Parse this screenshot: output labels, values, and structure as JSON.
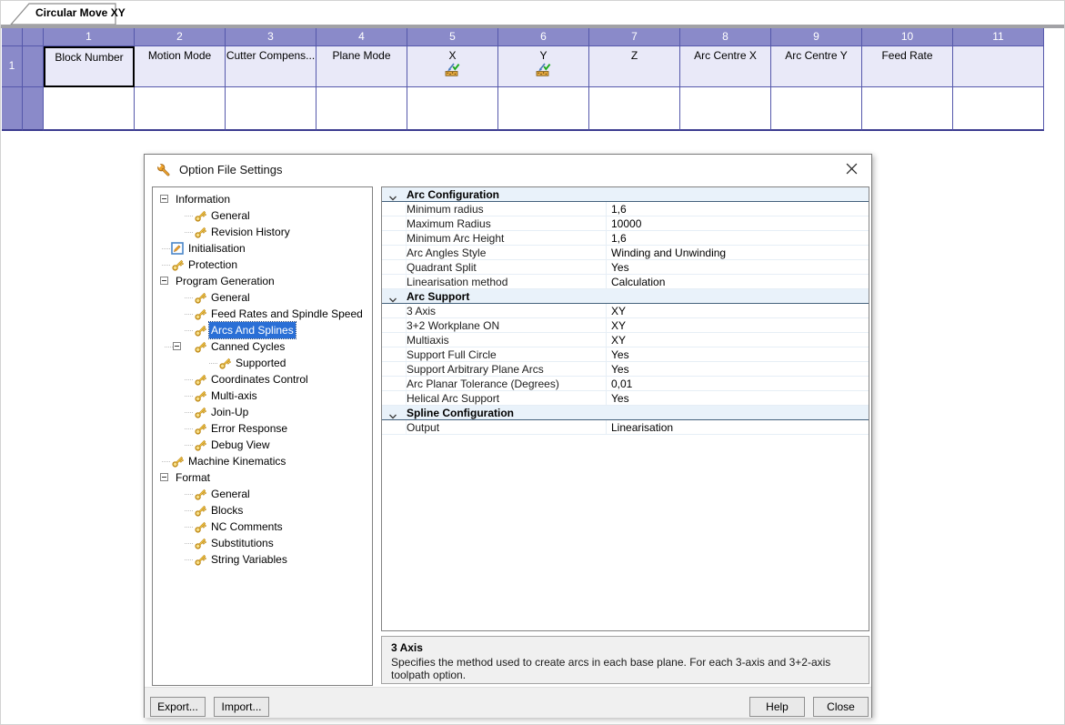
{
  "tab": {
    "label": "Circular Move XY"
  },
  "table": {
    "row_header": "1",
    "columns": [
      {
        "num": "1",
        "label": "Block Number",
        "selected": true
      },
      {
        "num": "2",
        "label": "Motion Mode"
      },
      {
        "num": "3",
        "label": "Cutter Compens..."
      },
      {
        "num": "4",
        "label": "Plane Mode"
      },
      {
        "num": "5",
        "label": "X",
        "icon": "assigned-parameter-icon"
      },
      {
        "num": "6",
        "label": "Y",
        "icon": "assigned-parameter-icon"
      },
      {
        "num": "7",
        "label": "Z"
      },
      {
        "num": "8",
        "label": "Arc Centre X"
      },
      {
        "num": "9",
        "label": "Arc Centre Y"
      },
      {
        "num": "10",
        "label": "Feed Rate"
      },
      {
        "num": "11",
        "label": ""
      }
    ]
  },
  "dialog": {
    "title": "Option File Settings",
    "icons": {
      "title": "wrench-icon",
      "close": "close-icon"
    },
    "tree": {
      "items": [
        {
          "label": "Information",
          "kind": "branch",
          "indent": 8
        },
        {
          "label": "General",
          "kind": "leaf",
          "icon": "key",
          "indent": 45
        },
        {
          "label": "Revision History",
          "kind": "leaf",
          "icon": "key",
          "indent": 45
        },
        {
          "label": "Initialisation",
          "kind": "leaf",
          "icon": "init",
          "indent": 20
        },
        {
          "label": "Protection",
          "kind": "leaf",
          "icon": "key",
          "indent": 20
        },
        {
          "label": "Program Generation",
          "kind": "branch",
          "indent": 8
        },
        {
          "label": "General",
          "kind": "leaf",
          "icon": "key",
          "indent": 45
        },
        {
          "label": "Feed Rates and Spindle Speed",
          "kind": "leaf",
          "icon": "key",
          "indent": 45
        },
        {
          "label": "Arcs And Splines",
          "kind": "leaf",
          "icon": "key",
          "indent": 45,
          "selected": true
        },
        {
          "label": "Canned Cycles",
          "kind": "leaf",
          "icon": "key",
          "indent": 45,
          "expander": 22
        },
        {
          "label": "Supported",
          "kind": "leaf",
          "icon": "key",
          "indent": 72
        },
        {
          "label": "Coordinates Control",
          "kind": "leaf",
          "icon": "key",
          "indent": 45
        },
        {
          "label": "Multi-axis",
          "kind": "leaf",
          "icon": "key",
          "indent": 45
        },
        {
          "label": "Join-Up",
          "kind": "leaf",
          "icon": "key",
          "indent": 45
        },
        {
          "label": "Error Response",
          "kind": "leaf",
          "icon": "key",
          "indent": 45
        },
        {
          "label": "Debug View",
          "kind": "leaf",
          "icon": "key",
          "indent": 45
        },
        {
          "label": "Machine Kinematics",
          "kind": "leaf",
          "icon": "key",
          "indent": 20
        },
        {
          "label": "Format",
          "kind": "branch",
          "indent": 8
        },
        {
          "label": "General",
          "kind": "leaf",
          "icon": "key",
          "indent": 45
        },
        {
          "label": "Blocks",
          "kind": "leaf",
          "icon": "key",
          "indent": 45
        },
        {
          "label": "NC Comments",
          "kind": "leaf",
          "icon": "key",
          "indent": 45
        },
        {
          "label": "Substitutions",
          "kind": "leaf",
          "icon": "key",
          "indent": 45
        },
        {
          "label": "String Variables",
          "kind": "leaf",
          "icon": "key",
          "indent": 45
        }
      ]
    },
    "grid": {
      "rows": [
        {
          "type": "section",
          "name": "Arc Configuration"
        },
        {
          "type": "prop",
          "name": "Minimum radius",
          "value": "1,6"
        },
        {
          "type": "prop",
          "name": "Maximum Radius",
          "value": "10000"
        },
        {
          "type": "prop",
          "name": "Minimum Arc Height",
          "value": "1,6"
        },
        {
          "type": "prop",
          "name": "Arc Angles Style",
          "value": "Winding and Unwinding"
        },
        {
          "type": "prop",
          "name": "Quadrant Split",
          "value": "Yes"
        },
        {
          "type": "prop",
          "name": "Linearisation method",
          "value": "Calculation"
        },
        {
          "type": "section",
          "name": "Arc Support"
        },
        {
          "type": "prop",
          "name": "3 Axis",
          "value": "XY"
        },
        {
          "type": "prop",
          "name": "3+2 Workplane ON",
          "value": "XY"
        },
        {
          "type": "prop",
          "name": "Multiaxis",
          "value": "XY"
        },
        {
          "type": "prop",
          "name": "Support Full Circle",
          "value": "Yes"
        },
        {
          "type": "prop",
          "name": "Support Arbitrary Plane Arcs",
          "value": "Yes"
        },
        {
          "type": "prop",
          "name": "Arc Planar Tolerance (Degrees)",
          "value": "0,01"
        },
        {
          "type": "prop",
          "name": "Helical Arc Support",
          "value": "Yes"
        },
        {
          "type": "section",
          "name": "Spline Configuration"
        },
        {
          "type": "prop",
          "name": "Output",
          "value": "Linearisation"
        }
      ]
    },
    "description": {
      "title": "3 Axis",
      "text": "Specifies the method used to create arcs in each base plane. For each 3-axis and 3+2-axis toolpath option."
    },
    "buttons": {
      "export": "Export...",
      "import": "Import...",
      "help": "Help",
      "close": "Close"
    }
  },
  "colors": {
    "header_purple": "#8a8ac9",
    "row_tint": "#e9e9f8",
    "grid_line": "#5558ab",
    "selection_blue": "#2a6fd6",
    "section_rule": "#44617c"
  }
}
